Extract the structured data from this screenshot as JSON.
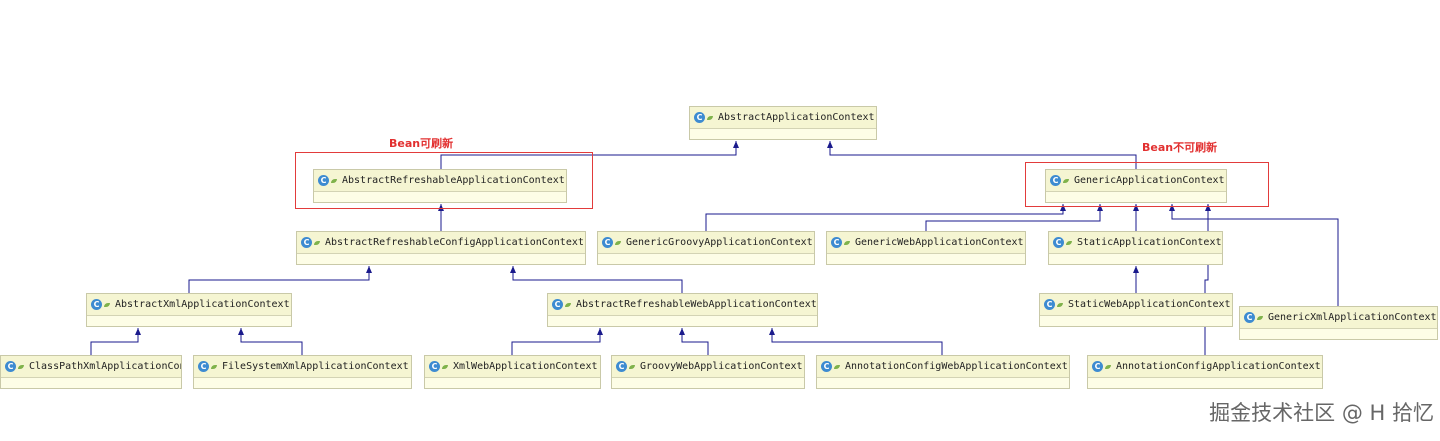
{
  "diagram": {
    "classes": [
      {
        "id": "aac",
        "name": "AbstractApplicationContext"
      },
      {
        "id": "arac",
        "name": "AbstractRefreshableApplicationContext"
      },
      {
        "id": "gac",
        "name": "GenericApplicationContext"
      },
      {
        "id": "arcac",
        "name": "AbstractRefreshableConfigApplicationContext"
      },
      {
        "id": "ggac",
        "name": "GenericGroovyApplicationContext"
      },
      {
        "id": "gwac",
        "name": "GenericWebApplicationContext"
      },
      {
        "id": "sac",
        "name": "StaticApplicationContext"
      },
      {
        "id": "axac",
        "name": "AbstractXmlApplicationContext"
      },
      {
        "id": "arwac",
        "name": "AbstractRefreshableWebApplicationContext"
      },
      {
        "id": "swac",
        "name": "StaticWebApplicationContext"
      },
      {
        "id": "gxac",
        "name": "GenericXmlApplicationContext"
      },
      {
        "id": "cpxac",
        "name": "ClassPathXmlApplicationContext"
      },
      {
        "id": "fsxac",
        "name": "FileSystemXmlApplicationContext"
      },
      {
        "id": "xwac",
        "name": "XmlWebApplicationContext"
      },
      {
        "id": "gvwac",
        "name": "GroovyWebApplicationContext"
      },
      {
        "id": "acwac",
        "name": "AnnotationConfigWebApplicationContext"
      },
      {
        "id": "acac",
        "name": "AnnotationConfigApplicationContext"
      }
    ],
    "inheritance": [
      {
        "child": "arac",
        "parent": "aac"
      },
      {
        "child": "gac",
        "parent": "aac"
      },
      {
        "child": "arcac",
        "parent": "arac"
      },
      {
        "child": "axac",
        "parent": "arcac"
      },
      {
        "child": "arwac",
        "parent": "arcac"
      },
      {
        "child": "cpxac",
        "parent": "axac"
      },
      {
        "child": "fsxac",
        "parent": "axac"
      },
      {
        "child": "xwac",
        "parent": "arwac"
      },
      {
        "child": "gvwac",
        "parent": "arwac"
      },
      {
        "child": "acwac",
        "parent": "arwac"
      },
      {
        "child": "ggac",
        "parent": "gac"
      },
      {
        "child": "gwac",
        "parent": "gac"
      },
      {
        "child": "sac",
        "parent": "gac"
      },
      {
        "child": "gxac",
        "parent": "gac"
      },
      {
        "child": "acac",
        "parent": "gac"
      },
      {
        "child": "swac",
        "parent": "sac"
      }
    ],
    "groups": [
      {
        "id": "refreshable",
        "label": "Bean可刷新"
      },
      {
        "id": "not-refreshable",
        "label": "Bean不可刷新"
      }
    ],
    "icon_glyph": "C",
    "colors": {
      "edge": "#1a1a8c",
      "group": "#e23b3b",
      "label": "#e23030"
    }
  },
  "watermark": "掘金技术社区 @ H 拾忆"
}
